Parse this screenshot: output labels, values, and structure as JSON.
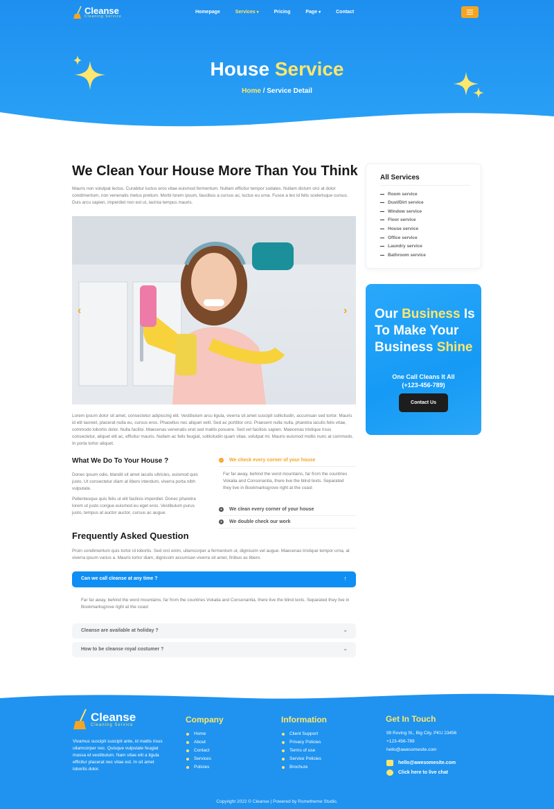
{
  "nav": {
    "logo_title": "Cleanse",
    "logo_sub": "Cleaning Service",
    "items": [
      {
        "label": "Homepage"
      },
      {
        "label": "Services"
      },
      {
        "label": "Pricing"
      },
      {
        "label": "Page"
      },
      {
        "label": "Contact"
      }
    ]
  },
  "hero": {
    "title_a": "House",
    "title_b": "Service",
    "crumb_home": "Home",
    "crumb_sep": " / ",
    "crumb_current": "Service Detail"
  },
  "main": {
    "title": "We Clean Your House More Than You Think",
    "intro": "Mauris non volutpat lectus. Curabitur luctus eros vitae euismod fermentum. Nullam efficitur tempor sodales. Nullam dictum orci at dolor condimentum, non venenatis metus pretium. Morbi lorem ipsum, faucibus a cursus ac, luctus eu urna. Fusce a leo id felis scelerisque cursus. Duis arcu sapien, imperdiet non est ut, lacinia tempus mauris.",
    "body": "Lorem ipsum dolor sit amet, consectetur adipiscing elit. Vestibulum arcu ligula, viverra sit amet suscipit sollicitudin, accumsan sed tortor. Mauris id elit laoreet, placerat nulla eu, cursus eros. Phasellus nec aliquet velit. Sed ac porttitor orci. Praesent nulla nulla, pharetra iaculis felis vitae, commodo lobortis dolor. Nulla facilisi. Maecenas venenatis erat sed mattis posuere. Sed vel facilisis sapien. Maecenas tristique risus consectetur, aliquet elit ac, efficitur mauris. Nullam ac felis feugiat, sollicitudin quam vitae, volutpat mi. Mauris euismod mollis nunc at commodo. In porta tortor aliquet.",
    "what_title": "What We Do To Your House ?",
    "what_p1": "Donec ipsum odio, blandit sit amet iaculis ultricies, euismod quis justo. Ut consectetur diam at libero interdum, viverra porta nibh vulputate.",
    "what_p2": "Pellentesque quis felis ut elit facilisis imperdiet. Donec pharetra lorem ut justo congue euismod eu eget eros. Vestibulum purus justo, tempus at auctor auctor, cursus ac augue.",
    "accordion": [
      {
        "label": "We check every corner of your house",
        "body": "Far far away, behind the word mountains, far from the countries Vokalia and Consonantia, there live the blind texts. Separated they live in Bookmarksgrove right at the coast"
      },
      {
        "label": "We clean every corner of your house"
      },
      {
        "label": "We double check our work"
      }
    ],
    "faq_title": "Frequently Asked Question",
    "faq_intro": "Proin condimentum quis tortor id lobortis. Sed orci enim, ullamcorper a fermentum ut, dignissim vel augue. Maecenas tristique tempor urna, at viverra ipsum varius a. Mauris tortor diam, dignissim accumsan viverra sit amet, finibus ac libero.",
    "faqs": [
      {
        "q": "Can we call cleanse at any time ?",
        "a": "Far far away, behind the word mountains, far from the countries Vokalia and Consonantia, there live the blind texts. Separated they live in Bookmarksgrove right at the coast"
      },
      {
        "q": "Cleanse are available at holiday ?"
      },
      {
        "q": "How to be cleanse royal costumer ?"
      }
    ]
  },
  "sidebar": {
    "title": "All Services",
    "items": [
      "Room service",
      "Dust/Dirt service",
      "Window service",
      "Floor service",
      "House service",
      "Office service",
      "Laundry service",
      "Bathroom service"
    ],
    "promo_l1a": "Our ",
    "promo_l1b": "Business",
    "promo_l1c": " Is",
    "promo_l2": "To Make Your",
    "promo_l3a": "Business ",
    "promo_l3b": "Shine",
    "call_text": "One Call Cleans It All",
    "phone": "(+123-456-789)",
    "button": "Contact Us"
  },
  "footer": {
    "logo_title": "Cleanse",
    "logo_sub": "Cleaning Service",
    "about": "Vivamus suscipit suscipit ante, id mattis risus ullamcorper nec. Quisque vulputate feugiat massa et vestibulum. Nam vitae elit a ligula efficitur placerat nec vitae est. In sit amet lobortis dolor.",
    "company_title": "Company",
    "company": [
      "Home",
      "About",
      "Contact",
      "Services",
      "Policies"
    ],
    "info_title": "Information",
    "info": [
      "Client Support",
      "Privacy Policies",
      "Terms of use",
      "Service Policies",
      "Brochure"
    ],
    "touch_title": "Get In Touch",
    "address": "99 Roving St., Big City, PKU 23456",
    "phone": "+123-456-789",
    "email_plain": "hello@awesomesite.com",
    "email_link": "hello@awesomesite.com",
    "chat": "Click here to live chat",
    "copyright": "Copyright 2022 © Cleanse | Powered by Rometheme Studio."
  },
  "colors": {
    "primary": "#1f93ef",
    "accent": "#ffe66d",
    "orange": "#f5a524",
    "dark": "#1d1d1d"
  }
}
